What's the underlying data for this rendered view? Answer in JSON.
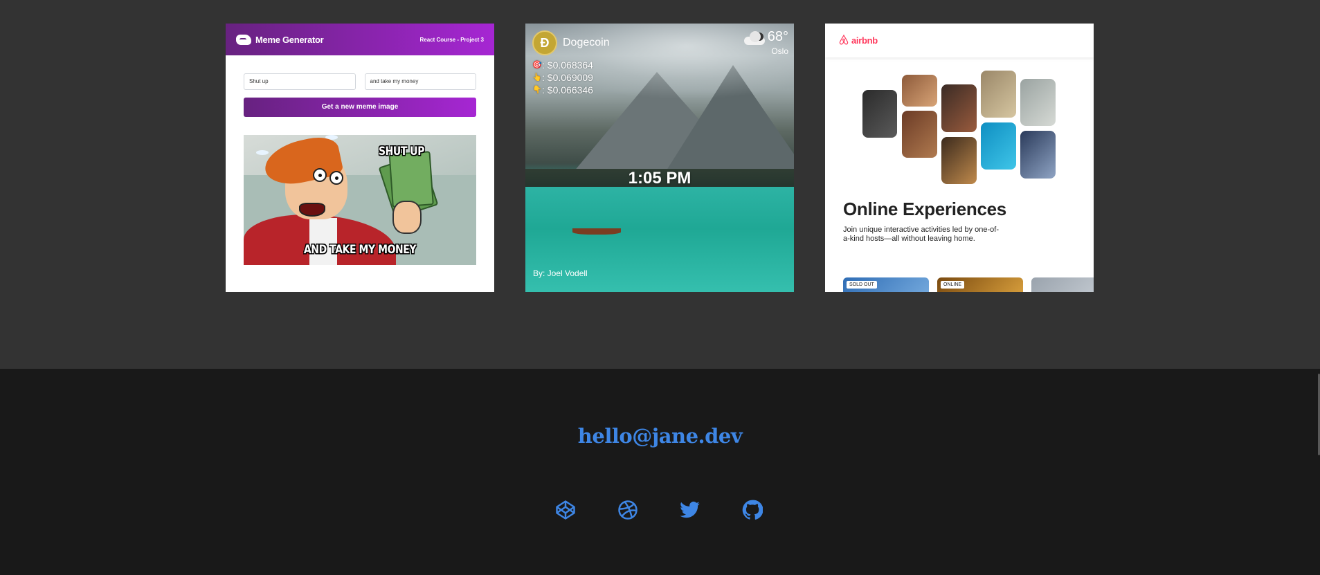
{
  "projects": {
    "meme": {
      "title": "Meme Generator",
      "subtitle": "React Course - Project 3",
      "top_text_value": "Shut up",
      "bottom_text_value": "and take my money",
      "button_label": "Get a new meme image",
      "meme_top": "SHUT UP",
      "meme_bottom": "AND TAKE MY MONEY"
    },
    "dashboard": {
      "coin_name": "Dogecoin",
      "coin_logo": "Ð",
      "prices": [
        {
          "icon": "target-icon",
          "glyph": "🎯",
          "value": ": $0.068364"
        },
        {
          "icon": "pointing-up-icon",
          "glyph": "👆",
          "value": ": $0.069009"
        },
        {
          "icon": "pointing-down-icon",
          "glyph": "👇",
          "value": ": $0.066346"
        }
      ],
      "temperature": "68°",
      "city": "Oslo",
      "time": "1:05 PM",
      "author": "By: Joel Vodell"
    },
    "airbnb": {
      "logo_text": "airbnb",
      "heading": "Online Experiences",
      "description": "Join unique interactive activities led by one-of-a-kind hosts—all without leaving home.",
      "badges": [
        "SOLD OUT",
        "ONLINE"
      ]
    }
  },
  "footer": {
    "email": "hello@jane.dev",
    "socials": [
      "codepen-icon",
      "dribbble-icon",
      "twitter-icon",
      "github-icon"
    ],
    "accent_color": "#3E86E5"
  }
}
